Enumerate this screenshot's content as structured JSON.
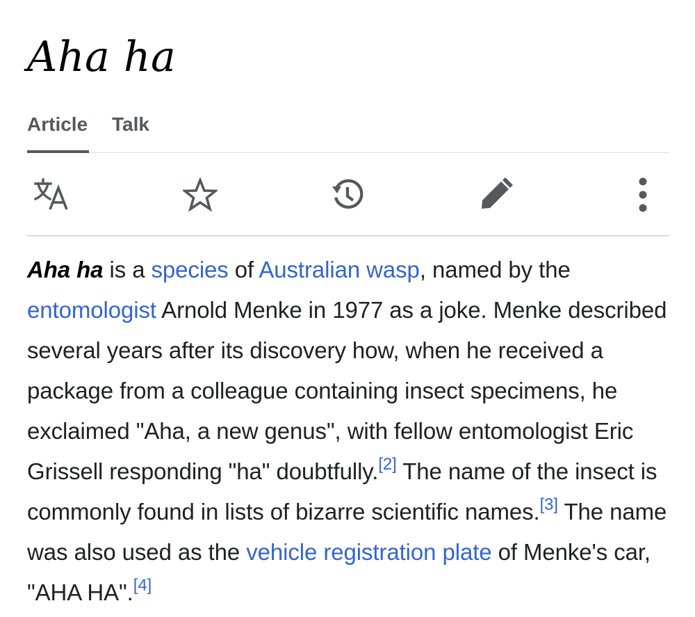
{
  "page": {
    "title": "Aha ha"
  },
  "tabs": [
    {
      "label": "Article",
      "active": true
    },
    {
      "label": "Talk",
      "active": false
    }
  ],
  "toolbar": {
    "items": [
      {
        "icon": "language-icon",
        "label": "Language"
      },
      {
        "icon": "star-icon",
        "label": "Watch"
      },
      {
        "icon": "history-icon",
        "label": "History"
      },
      {
        "icon": "pencil-icon",
        "label": "Edit"
      },
      {
        "icon": "more-vertical-icon",
        "label": "More"
      }
    ]
  },
  "article": {
    "subject": "Aha ha",
    "t1": " is a ",
    "link_species": "species",
    "t2": " of ",
    "link_wasp": "Australian wasp",
    "t3": ", named by the ",
    "link_entomologist": "entomologist",
    "t4": " Arnold Menke in 1977 as a joke. Menke described several years after its discovery how, when he received a package from a colleague containing insect specimens, he exclaimed \"Aha, a new genus\", with fellow entomologist Eric Grissell responding \"ha\" doubtfully.",
    "ref2": "[2]",
    "t5": " The name of the insect is commonly found in lists of bizarre scientific names.",
    "ref3": "[3]",
    "t6": " The name was also used as the ",
    "link_plate": "vehicle registration plate",
    "t7": " of Menke's car, \"AHA HA\".",
    "ref4": "[4]"
  },
  "colors": {
    "link": "#3366cc",
    "text": "#202122",
    "tab": "#54595d",
    "icon": "#54595d",
    "divider": "#dcdcdc"
  }
}
